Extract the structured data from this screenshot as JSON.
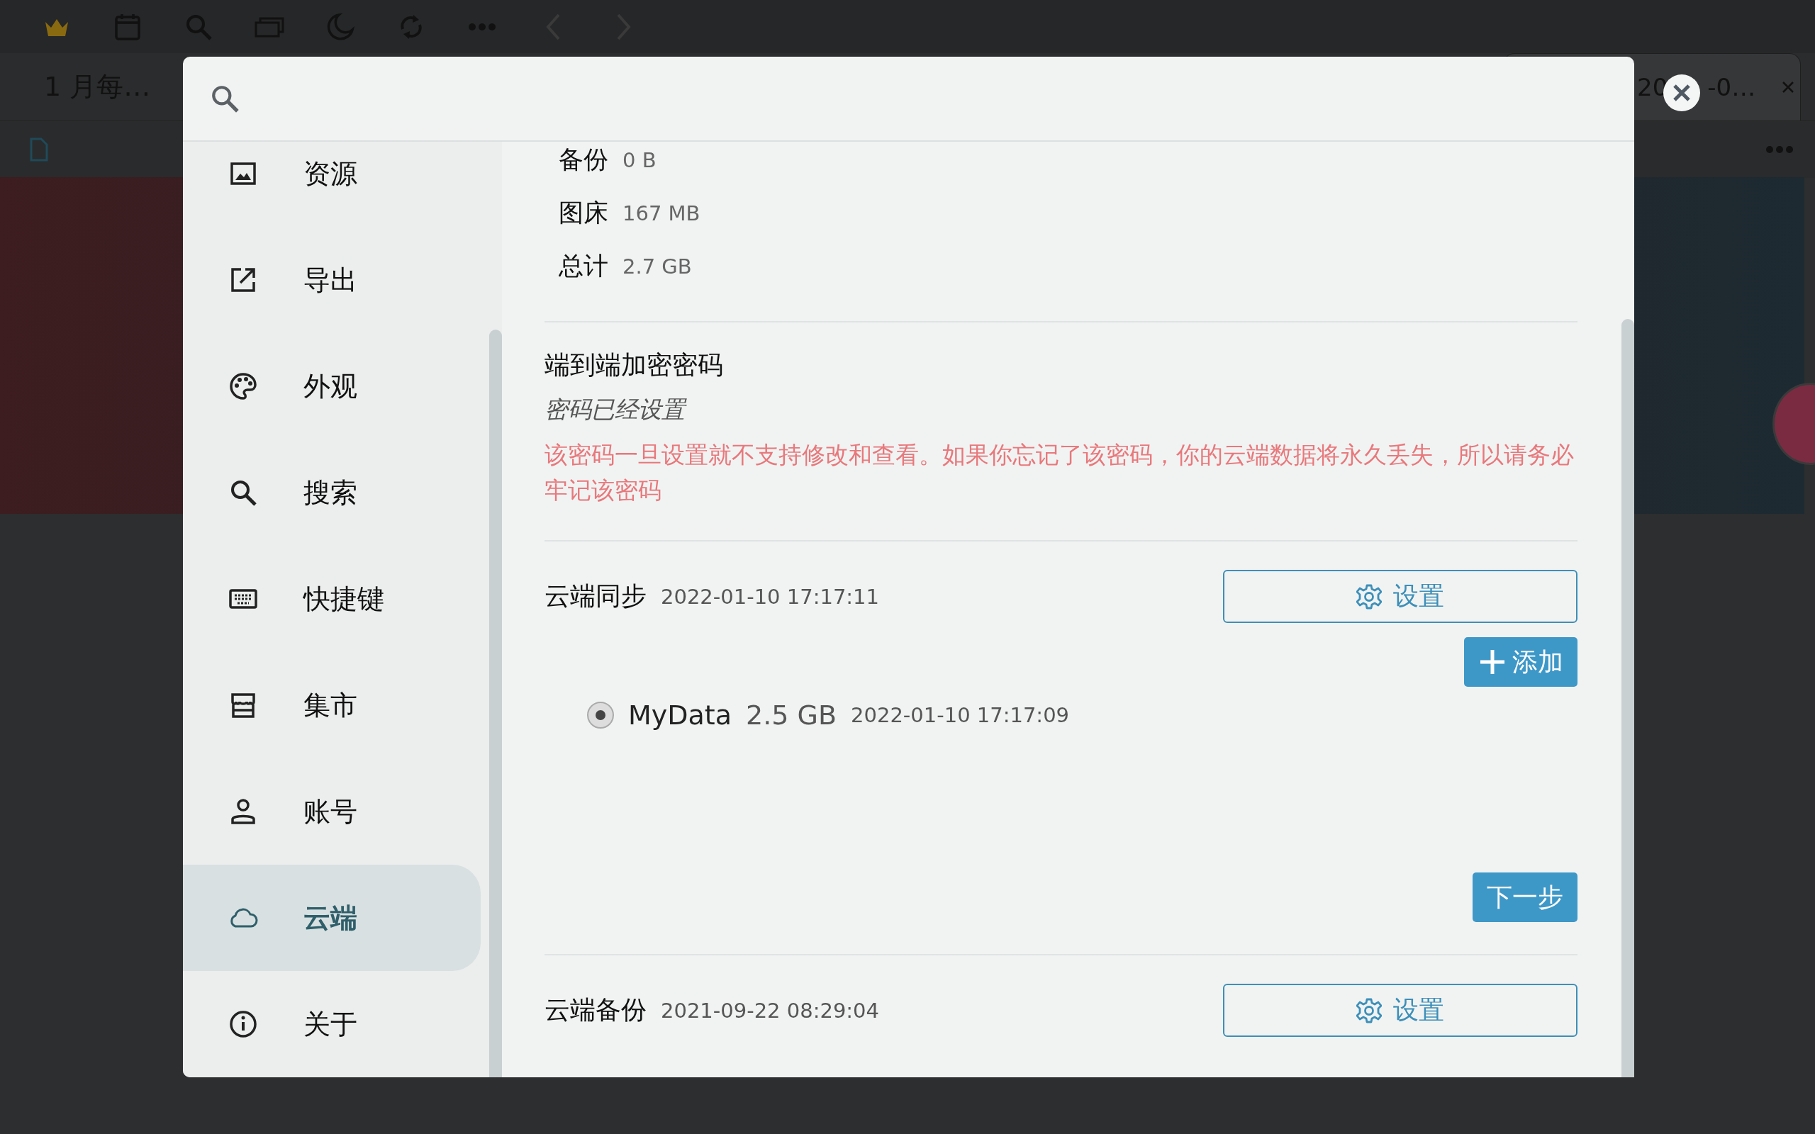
{
  "toolbar": {
    "icons": [
      {
        "kind": "crown"
      },
      {
        "kind": "calendar"
      },
      {
        "kind": "search"
      },
      {
        "kind": "windows"
      },
      {
        "kind": "moon"
      },
      {
        "kind": "sync"
      },
      {
        "kind": "more"
      },
      {
        "kind": "back"
      },
      {
        "kind": "forward"
      }
    ]
  },
  "tabs": [
    {
      "label": "1 月每…",
      "selected": false
    },
    {
      "label": "20",
      "label_after": "-0…",
      "selected": true
    }
  ],
  "dialog": {
    "sidebar": {
      "items": [
        {
          "kind": "image",
          "label": "资源",
          "selected": false
        },
        {
          "kind": "export",
          "label": "导出",
          "selected": false
        },
        {
          "kind": "palette",
          "label": "外观",
          "selected": false
        },
        {
          "kind": "search",
          "label": "搜索",
          "selected": false
        },
        {
          "kind": "keyboard",
          "label": "快捷键",
          "selected": false
        },
        {
          "kind": "store",
          "label": "集市",
          "selected": false
        },
        {
          "kind": "person",
          "label": "账号",
          "selected": false
        },
        {
          "kind": "cloud",
          "label": "云端",
          "selected": true
        },
        {
          "kind": "info",
          "label": "关于",
          "selected": false
        }
      ]
    },
    "usage": [
      {
        "label": "备份",
        "value": "0 B"
      },
      {
        "label": "图床",
        "value": "167 MB"
      },
      {
        "label": "总计",
        "value": "2.7 GB"
      }
    ],
    "encryption": {
      "title": "端到端加密密码",
      "status": "密码已经设置",
      "warning": "该密码一旦设置就不支持修改和查看。如果你忘记了该密码，你的云端数据将永久丢失，所以请务必牢记该密码"
    },
    "sync": {
      "title": "云端同步",
      "time": "2022-01-10 17:17:11",
      "settings_button": "设置",
      "add_button": "添加",
      "repos": [
        {
          "name": "MyData",
          "size": "2.5 GB",
          "time": "2022-01-10 17:17:09",
          "selected": true
        }
      ],
      "next_button": "下一步"
    },
    "backup": {
      "title": "云端备份",
      "time": "2021-09-22 08:29:04",
      "settings_button": "设置"
    }
  }
}
